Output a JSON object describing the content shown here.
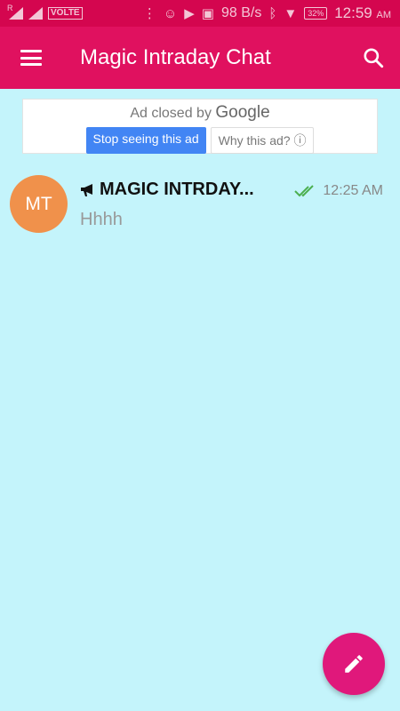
{
  "status_bar": {
    "carrier_flag": "R",
    "volte": "VOLTE",
    "net_speed": "98 B/s",
    "battery": "32%",
    "time": "12:59",
    "ampm": "AM"
  },
  "app_bar": {
    "title": "Magic Intraday Chat"
  },
  "ad": {
    "closed_by": "Ad closed by",
    "brand": "Google",
    "stop_label": "Stop seeing this ad",
    "why_label": "Why this ad?"
  },
  "chats": [
    {
      "initials": "MT",
      "name": "MAGIC INTRDAY...",
      "preview": "Hhhh",
      "time": "12:25 AM",
      "avatar_color": "#f0914b",
      "status_icon": "double-check-icon"
    }
  ],
  "colors": {
    "status_bar": "#d4064f",
    "app_bar": "#e0115f",
    "background": "#c4f4fb",
    "fab": "#e0187b",
    "read_check": "#4caf50"
  }
}
